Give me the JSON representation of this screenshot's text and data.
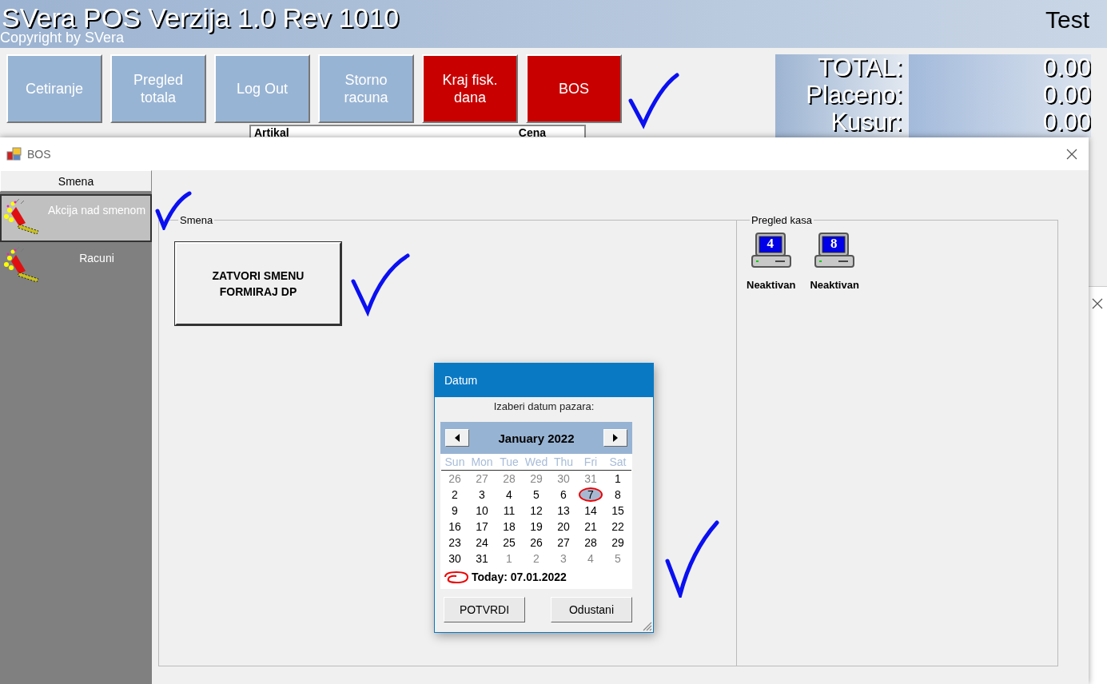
{
  "app": {
    "title": "SVera POS Verzija 1.0 Rev 1010",
    "copyright": "Copyright by SVera",
    "user": "Test"
  },
  "toolbar": [
    {
      "label": "Cetiranje",
      "kind": "normal"
    },
    {
      "label": "Pregled totala",
      "kind": "normal"
    },
    {
      "label": "Log Out",
      "kind": "normal"
    },
    {
      "label": "Storno racuna",
      "kind": "normal"
    },
    {
      "label": "Kraj fisk. dana",
      "kind": "danger"
    },
    {
      "label": "BOS",
      "kind": "danger"
    }
  ],
  "totals": [
    {
      "label": "TOTAL:",
      "value": "0.00"
    },
    {
      "label": "Placeno:",
      "value": "0.00"
    },
    {
      "label": "Kusur:",
      "value": "0.00"
    }
  ],
  "items_table": {
    "columns": [
      "Artikal",
      "Cena"
    ]
  },
  "bos_window": {
    "title": "BOS",
    "sidebar": {
      "header": "Smena",
      "items": [
        {
          "label": "Akcija nad smenom",
          "selected": true
        },
        {
          "label": "Racuni",
          "selected": false
        }
      ]
    },
    "shift_group": {
      "title": "Smena",
      "button": "ZATVORI SMENU FORMIRAJ DP"
    },
    "registers_group": {
      "title": "Pregled kasa",
      "registers": [
        {
          "number": "4",
          "status": "Neaktivan"
        },
        {
          "number": "8",
          "status": "Neaktivan"
        }
      ]
    }
  },
  "date_dialog": {
    "title": "Datum",
    "prompt": "Izaberi datum pazara:",
    "month": "January 2022",
    "weekdays": [
      "Sun",
      "Mon",
      "Tue",
      "Wed",
      "Thu",
      "Fri",
      "Sat"
    ],
    "days": [
      {
        "day": "26",
        "in_month": false,
        "selected": false,
        "today": false
      },
      {
        "day": "27",
        "in_month": false,
        "selected": false,
        "today": false
      },
      {
        "day": "28",
        "in_month": false,
        "selected": false,
        "today": false
      },
      {
        "day": "29",
        "in_month": false,
        "selected": false,
        "today": false
      },
      {
        "day": "30",
        "in_month": false,
        "selected": false,
        "today": false
      },
      {
        "day": "31",
        "in_month": false,
        "selected": false,
        "today": false
      },
      {
        "day": "1",
        "in_month": true,
        "selected": false,
        "today": false
      },
      {
        "day": "2",
        "in_month": true,
        "selected": false,
        "today": false
      },
      {
        "day": "3",
        "in_month": true,
        "selected": false,
        "today": false
      },
      {
        "day": "4",
        "in_month": true,
        "selected": false,
        "today": false
      },
      {
        "day": "5",
        "in_month": true,
        "selected": false,
        "today": false
      },
      {
        "day": "6",
        "in_month": true,
        "selected": false,
        "today": false
      },
      {
        "day": "7",
        "in_month": true,
        "selected": true,
        "today": true
      },
      {
        "day": "8",
        "in_month": true,
        "selected": false,
        "today": false
      },
      {
        "day": "9",
        "in_month": true,
        "selected": false,
        "today": false
      },
      {
        "day": "10",
        "in_month": true,
        "selected": false,
        "today": false
      },
      {
        "day": "11",
        "in_month": true,
        "selected": false,
        "today": false
      },
      {
        "day": "12",
        "in_month": true,
        "selected": false,
        "today": false
      },
      {
        "day": "13",
        "in_month": true,
        "selected": false,
        "today": false
      },
      {
        "day": "14",
        "in_month": true,
        "selected": false,
        "today": false
      },
      {
        "day": "15",
        "in_month": true,
        "selected": false,
        "today": false
      },
      {
        "day": "16",
        "in_month": true,
        "selected": false,
        "today": false
      },
      {
        "day": "17",
        "in_month": true,
        "selected": false,
        "today": false
      },
      {
        "day": "18",
        "in_month": true,
        "selected": false,
        "today": false
      },
      {
        "day": "19",
        "in_month": true,
        "selected": false,
        "today": false
      },
      {
        "day": "20",
        "in_month": true,
        "selected": false,
        "today": false
      },
      {
        "day": "21",
        "in_month": true,
        "selected": false,
        "today": false
      },
      {
        "day": "22",
        "in_month": true,
        "selected": false,
        "today": false
      },
      {
        "day": "23",
        "in_month": true,
        "selected": false,
        "today": false
      },
      {
        "day": "24",
        "in_month": true,
        "selected": false,
        "today": false
      },
      {
        "day": "25",
        "in_month": true,
        "selected": false,
        "today": false
      },
      {
        "day": "26",
        "in_month": true,
        "selected": false,
        "today": false
      },
      {
        "day": "27",
        "in_month": true,
        "selected": false,
        "today": false
      },
      {
        "day": "28",
        "in_month": true,
        "selected": false,
        "today": false
      },
      {
        "day": "29",
        "in_month": true,
        "selected": false,
        "today": false
      },
      {
        "day": "30",
        "in_month": true,
        "selected": false,
        "today": false
      },
      {
        "day": "31",
        "in_month": true,
        "selected": false,
        "today": false
      },
      {
        "day": "1",
        "in_month": false,
        "selected": false,
        "today": false
      },
      {
        "day": "2",
        "in_month": false,
        "selected": false,
        "today": false
      },
      {
        "day": "3",
        "in_month": false,
        "selected": false,
        "today": false
      },
      {
        "day": "4",
        "in_month": false,
        "selected": false,
        "today": false
      },
      {
        "day": "5",
        "in_month": false,
        "selected": false,
        "today": false
      }
    ],
    "today": "Today: 07.01.2022",
    "buttons": [
      "POTVRDI",
      "Odustani"
    ]
  }
}
